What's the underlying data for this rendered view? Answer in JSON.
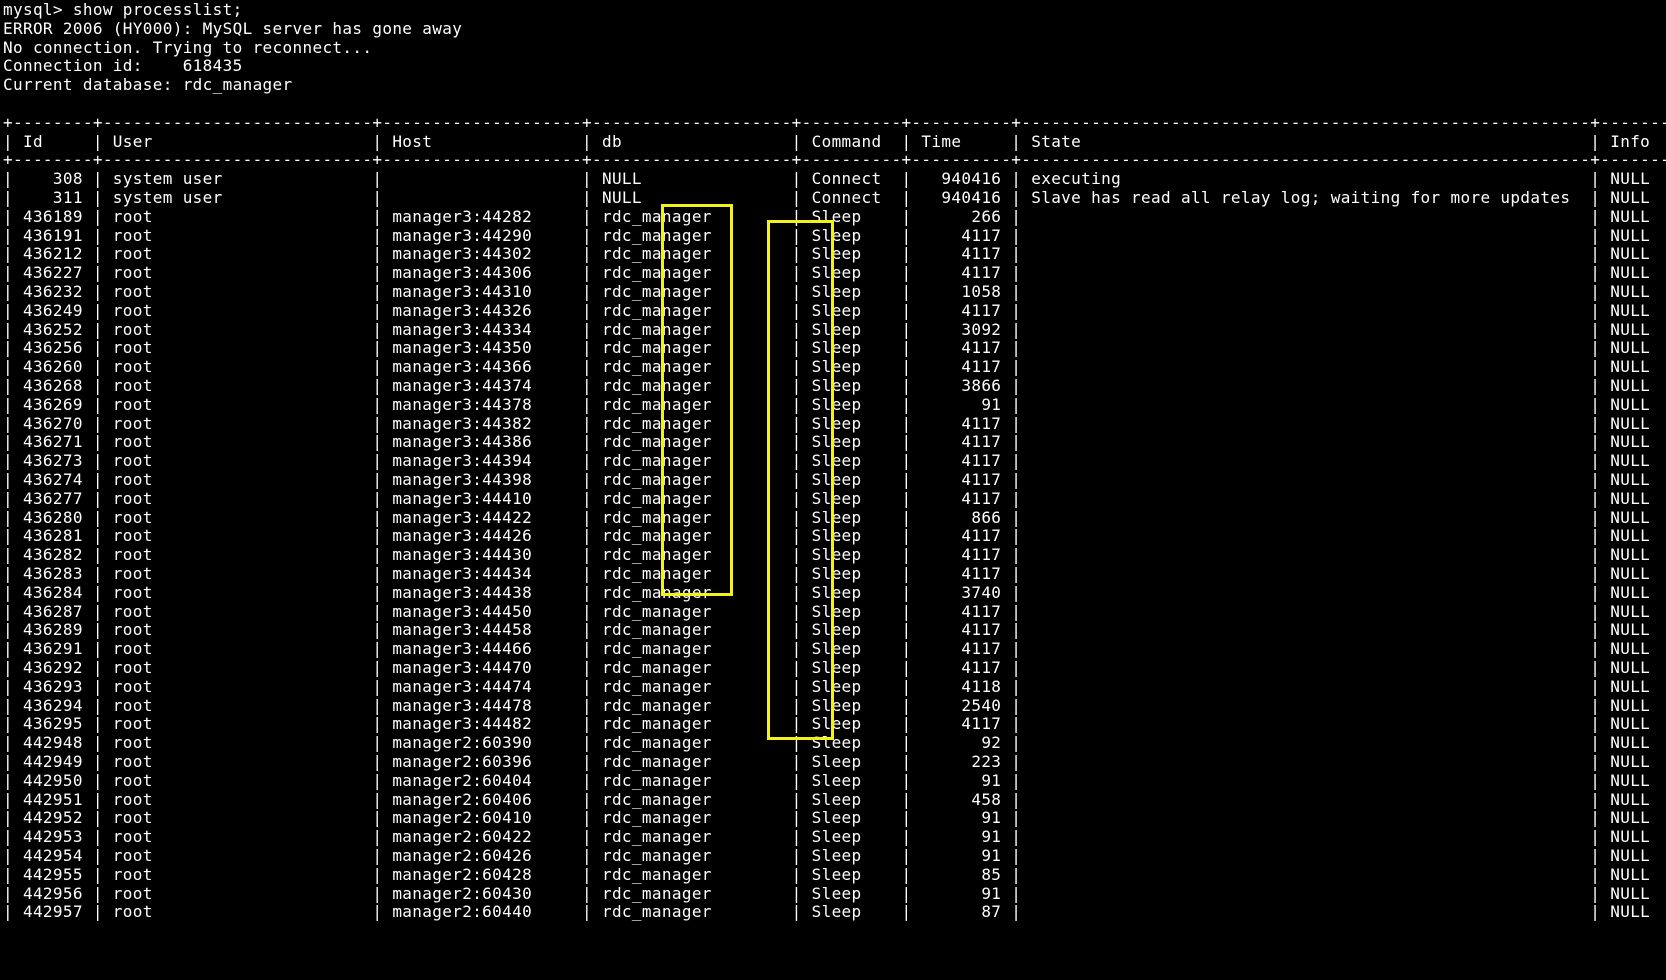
{
  "terminal": {
    "text_color": "#ffffff",
    "background": "#000000",
    "highlight_color": "#f2f21a",
    "preamble": [
      "mysql> show processlist;",
      "ERROR 2006 (HY000): MySQL server has gone away",
      "No connection. Trying to reconnect...",
      "Connection id:    618435",
      "Current database: rdc_manager",
      ""
    ],
    "table": {
      "border_line": "+--------+---------------------------+--------------------+--------------------+----------+----------+---------------------------------------------------------+--------------------+",
      "columns": [
        "Id",
        "User",
        "Host",
        "db",
        "Command",
        "Time",
        "State",
        "Info"
      ],
      "rows": [
        [
          "308",
          "system user",
          "",
          "NULL",
          "Connect",
          "940416",
          "executing",
          "NULL"
        ],
        [
          "311",
          "system user",
          "",
          "NULL",
          "Connect",
          "940416",
          "Slave has read all relay log; waiting for more updates",
          "NULL"
        ],
        [
          "436189",
          "root",
          "manager3:44282",
          "rdc_manager",
          "Sleep",
          "266",
          "",
          "NULL"
        ],
        [
          "436191",
          "root",
          "manager3:44290",
          "rdc_manager",
          "Sleep",
          "4117",
          "",
          "NULL"
        ],
        [
          "436212",
          "root",
          "manager3:44302",
          "rdc_manager",
          "Sleep",
          "4117",
          "",
          "NULL"
        ],
        [
          "436227",
          "root",
          "manager3:44306",
          "rdc_manager",
          "Sleep",
          "4117",
          "",
          "NULL"
        ],
        [
          "436232",
          "root",
          "manager3:44310",
          "rdc_manager",
          "Sleep",
          "1058",
          "",
          "NULL"
        ],
        [
          "436249",
          "root",
          "manager3:44326",
          "rdc_manager",
          "Sleep",
          "4117",
          "",
          "NULL"
        ],
        [
          "436252",
          "root",
          "manager3:44334",
          "rdc_manager",
          "Sleep",
          "3092",
          "",
          "NULL"
        ],
        [
          "436256",
          "root",
          "manager3:44350",
          "rdc_manager",
          "Sleep",
          "4117",
          "",
          "NULL"
        ],
        [
          "436260",
          "root",
          "manager3:44366",
          "rdc_manager",
          "Sleep",
          "4117",
          "",
          "NULL"
        ],
        [
          "436268",
          "root",
          "manager3:44374",
          "rdc_manager",
          "Sleep",
          "3866",
          "",
          "NULL"
        ],
        [
          "436269",
          "root",
          "manager3:44378",
          "rdc_manager",
          "Sleep",
          "91",
          "",
          "NULL"
        ],
        [
          "436270",
          "root",
          "manager3:44382",
          "rdc_manager",
          "Sleep",
          "4117",
          "",
          "NULL"
        ],
        [
          "436271",
          "root",
          "manager3:44386",
          "rdc_manager",
          "Sleep",
          "4117",
          "",
          "NULL"
        ],
        [
          "436273",
          "root",
          "manager3:44394",
          "rdc_manager",
          "Sleep",
          "4117",
          "",
          "NULL"
        ],
        [
          "436274",
          "root",
          "manager3:44398",
          "rdc_manager",
          "Sleep",
          "4117",
          "",
          "NULL"
        ],
        [
          "436277",
          "root",
          "manager3:44410",
          "rdc_manager",
          "Sleep",
          "4117",
          "",
          "NULL"
        ],
        [
          "436280",
          "root",
          "manager3:44422",
          "rdc_manager",
          "Sleep",
          "866",
          "",
          "NULL"
        ],
        [
          "436281",
          "root",
          "manager3:44426",
          "rdc_manager",
          "Sleep",
          "4117",
          "",
          "NULL"
        ],
        [
          "436282",
          "root",
          "manager3:44430",
          "rdc_manager",
          "Sleep",
          "4117",
          "",
          "NULL"
        ],
        [
          "436283",
          "root",
          "manager3:44434",
          "rdc_manager",
          "Sleep",
          "4117",
          "",
          "NULL"
        ],
        [
          "436284",
          "root",
          "manager3:44438",
          "rdc_manager",
          "Sleep",
          "3740",
          "",
          "NULL"
        ],
        [
          "436287",
          "root",
          "manager3:44450",
          "rdc_manager",
          "Sleep",
          "4117",
          "",
          "NULL"
        ],
        [
          "436289",
          "root",
          "manager3:44458",
          "rdc_manager",
          "Sleep",
          "4117",
          "",
          "NULL"
        ],
        [
          "436291",
          "root",
          "manager3:44466",
          "rdc_manager",
          "Sleep",
          "4117",
          "",
          "NULL"
        ],
        [
          "436292",
          "root",
          "manager3:44470",
          "rdc_manager",
          "Sleep",
          "4117",
          "",
          "NULL"
        ],
        [
          "436293",
          "root",
          "manager3:44474",
          "rdc_manager",
          "Sleep",
          "4118",
          "",
          "NULL"
        ],
        [
          "436294",
          "root",
          "manager3:44478",
          "rdc_manager",
          "Sleep",
          "2540",
          "",
          "NULL"
        ],
        [
          "436295",
          "root",
          "manager3:44482",
          "rdc_manager",
          "Sleep",
          "4117",
          "",
          "NULL"
        ],
        [
          "442948",
          "root",
          "manager2:60390",
          "rdc_manager",
          "Sleep",
          "92",
          "",
          "NULL"
        ],
        [
          "442949",
          "root",
          "manager2:60396",
          "rdc_manager",
          "Sleep",
          "223",
          "",
          "NULL"
        ],
        [
          "442950",
          "root",
          "manager2:60404",
          "rdc_manager",
          "Sleep",
          "91",
          "",
          "NULL"
        ],
        [
          "442951",
          "root",
          "manager2:60406",
          "rdc_manager",
          "Sleep",
          "458",
          "",
          "NULL"
        ],
        [
          "442952",
          "root",
          "manager2:60410",
          "rdc_manager",
          "Sleep",
          "91",
          "",
          "NULL"
        ],
        [
          "442953",
          "root",
          "manager2:60422",
          "rdc_manager",
          "Sleep",
          "91",
          "",
          "NULL"
        ],
        [
          "442954",
          "root",
          "manager2:60426",
          "rdc_manager",
          "Sleep",
          "91",
          "",
          "NULL"
        ],
        [
          "442955",
          "root",
          "manager2:60428",
          "rdc_manager",
          "Sleep",
          "85",
          "",
          "NULL"
        ],
        [
          "442956",
          "root",
          "manager2:60430",
          "rdc_manager",
          "Sleep",
          "91",
          "",
          "NULL"
        ],
        [
          "442957",
          "root",
          "manager2:60440",
          "rdc_manager",
          "Sleep",
          "87",
          "",
          "NULL"
        ]
      ]
    }
  }
}
